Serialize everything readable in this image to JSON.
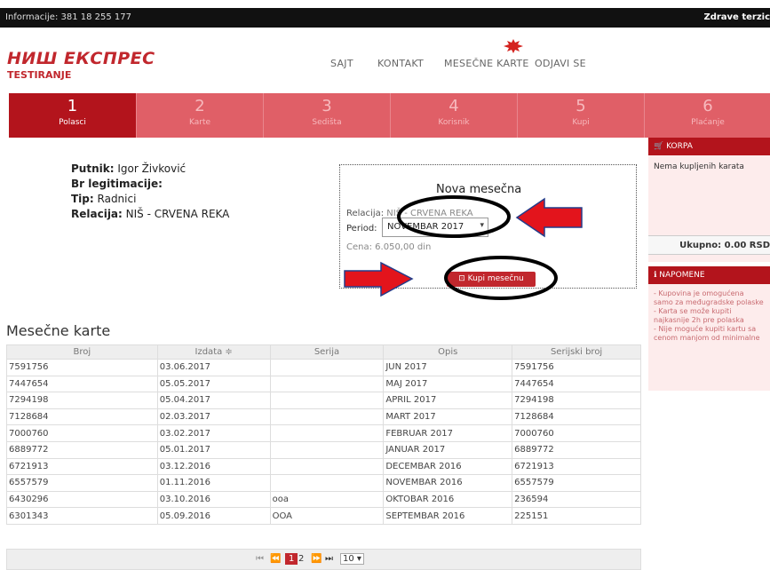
{
  "topbar": {
    "info": "Informacije: 381 18 255 177",
    "greeting": "Zdrave terzic"
  },
  "logo": {
    "brand": "НИШ ЕКСПРЕС",
    "sub": "TESTIRANJE"
  },
  "nav": [
    "SAJT",
    "KONTAKT",
    "MESEČNE KARTE",
    "ODJAVI SE"
  ],
  "steps": [
    {
      "num": "1",
      "label": "Polasci"
    },
    {
      "num": "2",
      "label": "Karte"
    },
    {
      "num": "3",
      "label": "Sedišta"
    },
    {
      "num": "4",
      "label": "Korisnik"
    },
    {
      "num": "5",
      "label": "Kupi"
    },
    {
      "num": "6",
      "label": "Plaćanje"
    }
  ],
  "passenger": {
    "name_label": "Putnik:",
    "name": "Igor Živković",
    "id_label": "Br legitimacije:",
    "id": "",
    "type_label": "Tip:",
    "type": "Radnici",
    "rel_label": "Relacija:",
    "rel": "NIŠ - CRVENA REKA"
  },
  "card": {
    "title": "Nova mesečna",
    "rel_label": "Relacija:",
    "rel_value": "NIŠ - CRVENA REKA",
    "period_label": "Period:",
    "period_value": "NOVEMBAR 2017",
    "cena_label": "Cena:",
    "cena_value": "6.050,00 din",
    "buy": "Kupi mesečnu"
  },
  "korpa": {
    "title": "KORPA",
    "empty": "Nema kupljenih karata",
    "total": "Ukupno: 0.00 RSD"
  },
  "napomene": {
    "title": "NAPOMENE",
    "items": [
      "- Kupovina je omogućena samo za međugradske polaske",
      "- Karta se može kupiti najkasnije 2h pre polaska",
      "- Nije moguće kupiti kartu sa cenom manjom od minimalne"
    ]
  },
  "section_title": "Mesečne karte",
  "table": {
    "headers": [
      "Broj",
      "Izdata ≑",
      "Serija",
      "Opis",
      "Serijski broj"
    ],
    "rows": [
      [
        "7591756",
        "03.06.2017",
        "",
        "JUN 2017",
        "7591756"
      ],
      [
        "7447654",
        "05.05.2017",
        "",
        "MAJ 2017",
        "7447654"
      ],
      [
        "7294198",
        "05.04.2017",
        "",
        "APRIL 2017",
        "7294198"
      ],
      [
        "7128684",
        "02.03.2017",
        "",
        "MART 2017",
        "7128684"
      ],
      [
        "7000760",
        "03.02.2017",
        "",
        "FEBRUAR 2017",
        "7000760"
      ],
      [
        "6889772",
        "05.01.2017",
        "",
        "JANUAR 2017",
        "6889772"
      ],
      [
        "6721913",
        "03.12.2016",
        "",
        "DECEMBAR 2016",
        "6721913"
      ],
      [
        "6557579",
        "01.11.2016",
        "",
        "NOVEMBAR 2016",
        "6557579"
      ],
      [
        "6430296",
        "03.10.2016",
        "ooa",
        "OKTOBAR 2016",
        "236594"
      ],
      [
        "6301343",
        "05.09.2016",
        "OOA",
        "SEPTEMBAR 2016",
        "225151"
      ]
    ]
  },
  "pager": {
    "first": "⏮",
    "prev": "⏪",
    "p1": "1",
    "p2": "2",
    "next": "⏩",
    "last": "⏭",
    "size": "10 ▾"
  }
}
